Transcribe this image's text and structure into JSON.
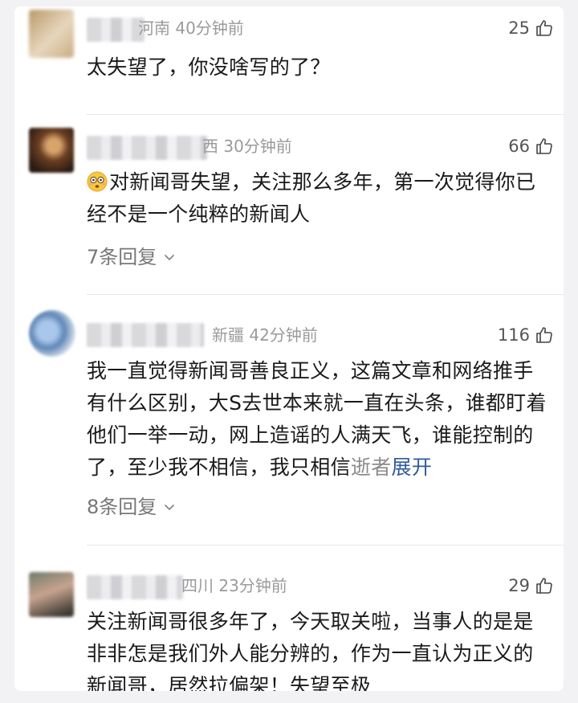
{
  "comments": [
    {
      "location_time": "河南 40分钟前",
      "likes": "25",
      "text": "太失望了，你没啥写的了？"
    },
    {
      "location_time": "西 30分钟前",
      "likes": "66",
      "text": "对新闻哥失望，关注那么多年，第一次觉得你已经不是一个纯粹的新闻人",
      "replies": "7条回复"
    },
    {
      "location_time": "新疆 42分钟前",
      "likes": "116",
      "text_main": "我一直觉得新闻哥善良正义，这篇文章和网络推手有什么区别，大S去世本来就一直在头条，谁都盯着他们一举一动，网上造谣的人满天飞，谁能控制的了，至少我不相信，我只相信",
      "text_fade": "逝者",
      "expand": "展开",
      "replies": "8条回复"
    },
    {
      "location_time": "四川 23分钟前",
      "likes": "29",
      "text": "关注新闻哥很多年了，今天取关啦，当事人的是是非非怎是我们外人能分辨的，作为一直认为正义的新闻哥，居然拉偏架！失望至极"
    }
  ],
  "icons": {
    "like": "thumbs-up-outline-icon",
    "chevron": "chevron-down-icon",
    "emoji": "flushed-face-emoji"
  },
  "colors": {
    "expand_link": "#2f5a9e",
    "meta_text": "#9a9a9a"
  }
}
